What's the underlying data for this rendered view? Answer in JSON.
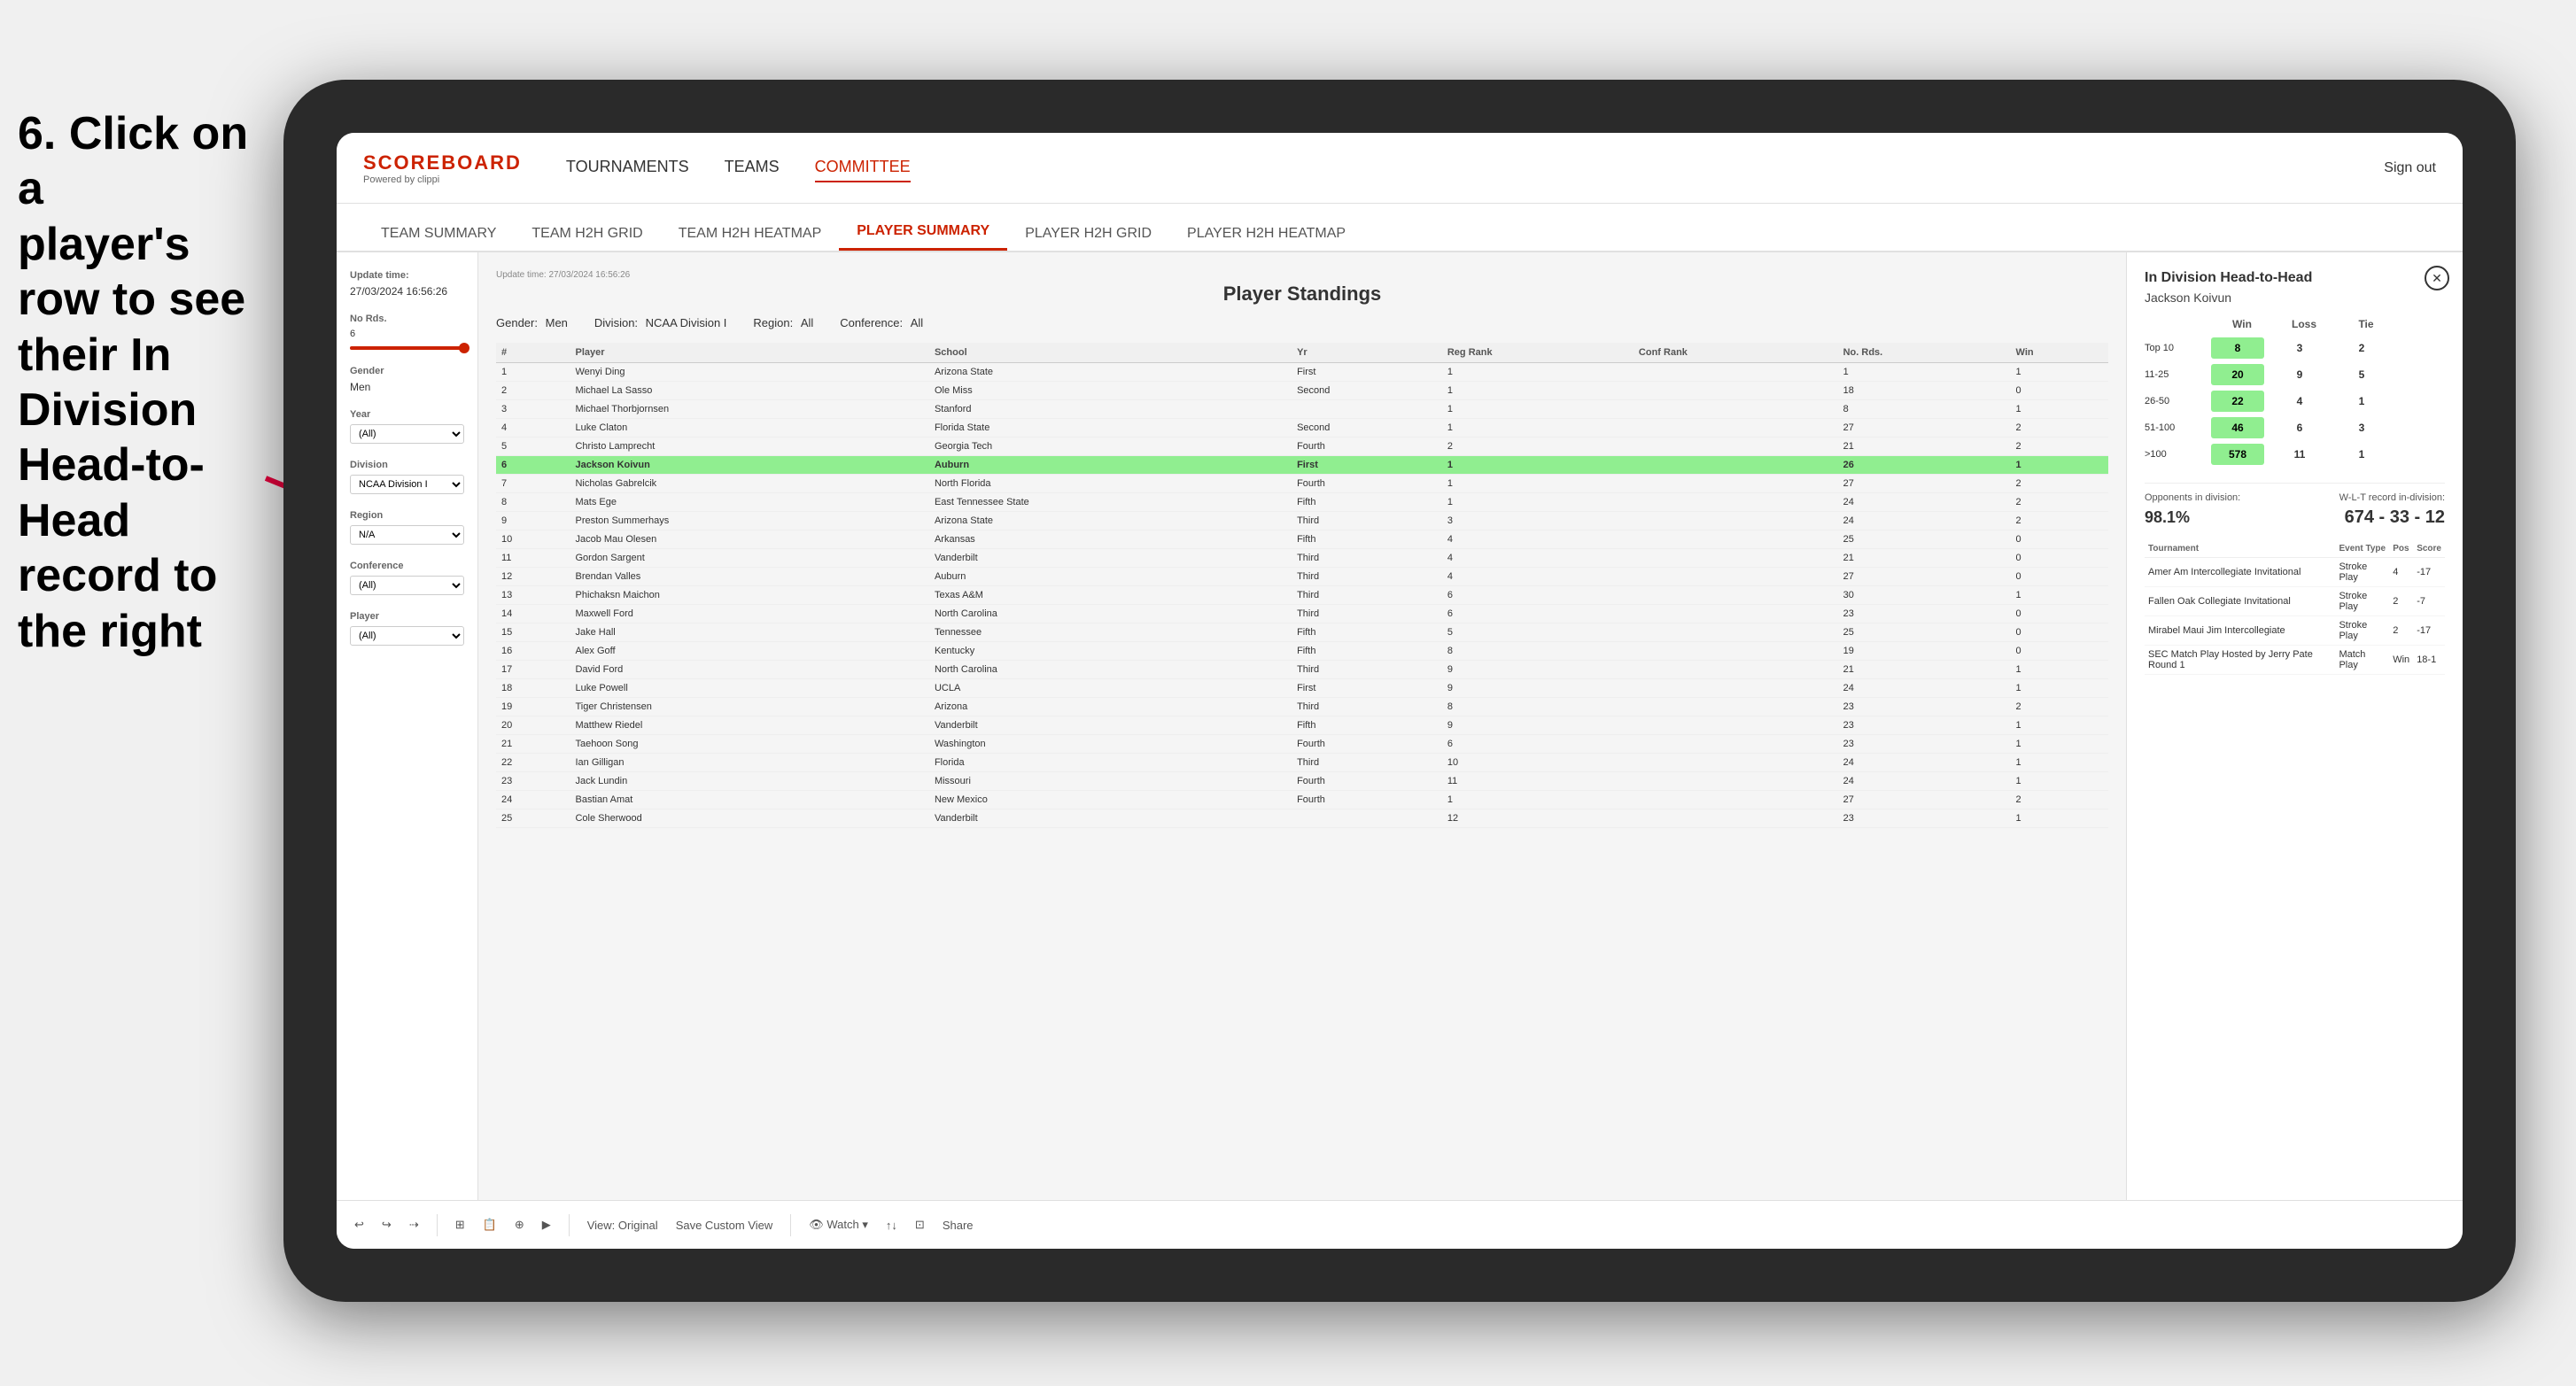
{
  "instruction": {
    "line1": "6. Click on a",
    "line2": "player's row to see",
    "line3": "their In Division",
    "line4": "Head-to-Head",
    "line5": "record to the right"
  },
  "nav": {
    "logo": "SCOREBOARD",
    "logo_sub": "Powered by clippi",
    "items": [
      "TOURNAMENTS",
      "TEAMS",
      "COMMITTEE"
    ],
    "sign_out": "Sign out"
  },
  "sub_nav": {
    "items": [
      "TEAM SUMMARY",
      "TEAM H2H GRID",
      "TEAM H2H HEATMAP",
      "PLAYER SUMMARY",
      "PLAYER H2H GRID",
      "PLAYER H2H HEATMAP"
    ],
    "active": "PLAYER SUMMARY"
  },
  "sidebar": {
    "update_time_label": "Update time:",
    "update_time": "27/03/2024 16:56:26",
    "no_rds_label": "No Rds.",
    "no_rds_value": "6",
    "no_rds_display": "6",
    "gender_label": "Gender",
    "gender_value": "Men",
    "year_label": "Year",
    "year_value": "(All)",
    "division_label": "Division",
    "division_value": "NCAA Division I",
    "region_label": "Region",
    "region_value": "N/A",
    "conference_label": "Conference",
    "conference_value": "(All)",
    "player_label": "Player",
    "player_value": "(All)"
  },
  "standings": {
    "title": "Player Standings",
    "gender_label": "Gender:",
    "gender_value": "Men",
    "division_label": "Division:",
    "division_value": "NCAA Division I",
    "region_label": "Region:",
    "region_value": "All",
    "conference_label": "Conference:",
    "conference_value": "All",
    "columns": [
      "#",
      "Player",
      "School",
      "Yr",
      "Reg Rank",
      "Conf Rank",
      "No. Rds.",
      "Win"
    ],
    "rows": [
      {
        "num": 1,
        "player": "Wenyi Ding",
        "school": "Arizona State",
        "yr": "First",
        "reg_rank": 1,
        "conf_rank": "",
        "no_rds": 1,
        "win": 1
      },
      {
        "num": 2,
        "player": "Michael La Sasso",
        "school": "Ole Miss",
        "yr": "Second",
        "reg_rank": 1,
        "conf_rank": "",
        "no_rds": 18,
        "win": 0
      },
      {
        "num": 3,
        "player": "Michael Thorbjornsen",
        "school": "Stanford",
        "yr": "",
        "reg_rank": 1,
        "conf_rank": "",
        "no_rds": 8,
        "win": 1
      },
      {
        "num": 4,
        "player": "Luke Claton",
        "school": "Florida State",
        "yr": "Second",
        "reg_rank": 1,
        "conf_rank": "",
        "no_rds": 27,
        "win": 2
      },
      {
        "num": 5,
        "player": "Christo Lamprecht",
        "school": "Georgia Tech",
        "yr": "Fourth",
        "reg_rank": 2,
        "conf_rank": "",
        "no_rds": 21,
        "win": 2
      },
      {
        "num": 6,
        "player": "Jackson Koivun",
        "school": "Auburn",
        "yr": "First",
        "reg_rank": 1,
        "conf_rank": "",
        "no_rds": 26,
        "win": 1,
        "highlighted": true
      },
      {
        "num": 7,
        "player": "Nicholas Gabrelcik",
        "school": "North Florida",
        "yr": "Fourth",
        "reg_rank": 1,
        "conf_rank": "",
        "no_rds": 27,
        "win": 2
      },
      {
        "num": 8,
        "player": "Mats Ege",
        "school": "East Tennessee State",
        "yr": "Fifth",
        "reg_rank": 1,
        "conf_rank": "",
        "no_rds": 24,
        "win": 2
      },
      {
        "num": 9,
        "player": "Preston Summerhays",
        "school": "Arizona State",
        "yr": "Third",
        "reg_rank": 3,
        "conf_rank": "",
        "no_rds": 24,
        "win": 2
      },
      {
        "num": 10,
        "player": "Jacob Mau Olesen",
        "school": "Arkansas",
        "yr": "Fifth",
        "reg_rank": 4,
        "conf_rank": "",
        "no_rds": 25,
        "win": 0
      },
      {
        "num": 11,
        "player": "Gordon Sargent",
        "school": "Vanderbilt",
        "yr": "Third",
        "reg_rank": 4,
        "conf_rank": "",
        "no_rds": 21,
        "win": 0
      },
      {
        "num": 12,
        "player": "Brendan Valles",
        "school": "Auburn",
        "yr": "Third",
        "reg_rank": 4,
        "conf_rank": "",
        "no_rds": 27,
        "win": 0
      },
      {
        "num": 13,
        "player": "Phichaksn Maichon",
        "school": "Texas A&M",
        "yr": "Third",
        "reg_rank": 6,
        "conf_rank": "",
        "no_rds": 30,
        "win": 1
      },
      {
        "num": 14,
        "player": "Maxwell Ford",
        "school": "North Carolina",
        "yr": "Third",
        "reg_rank": 6,
        "conf_rank": "",
        "no_rds": 23,
        "win": 0
      },
      {
        "num": 15,
        "player": "Jake Hall",
        "school": "Tennessee",
        "yr": "Fifth",
        "reg_rank": 5,
        "conf_rank": "",
        "no_rds": 25,
        "win": 0
      },
      {
        "num": 16,
        "player": "Alex Goff",
        "school": "Kentucky",
        "yr": "Fifth",
        "reg_rank": 8,
        "conf_rank": "",
        "no_rds": 19,
        "win": 0
      },
      {
        "num": 17,
        "player": "David Ford",
        "school": "North Carolina",
        "yr": "Third",
        "reg_rank": 9,
        "conf_rank": "",
        "no_rds": 21,
        "win": 1
      },
      {
        "num": 18,
        "player": "Luke Powell",
        "school": "UCLA",
        "yr": "First",
        "reg_rank": 9,
        "conf_rank": "",
        "no_rds": 24,
        "win": 1
      },
      {
        "num": 19,
        "player": "Tiger Christensen",
        "school": "Arizona",
        "yr": "Third",
        "reg_rank": 8,
        "conf_rank": "",
        "no_rds": 23,
        "win": 2
      },
      {
        "num": 20,
        "player": "Matthew Riedel",
        "school": "Vanderbilt",
        "yr": "Fifth",
        "reg_rank": 9,
        "conf_rank": "",
        "no_rds": 23,
        "win": 1
      },
      {
        "num": 21,
        "player": "Taehoon Song",
        "school": "Washington",
        "yr": "Fourth",
        "reg_rank": 6,
        "conf_rank": "",
        "no_rds": 23,
        "win": 1
      },
      {
        "num": 22,
        "player": "Ian Gilligan",
        "school": "Florida",
        "yr": "Third",
        "reg_rank": 10,
        "conf_rank": "",
        "no_rds": 24,
        "win": 1
      },
      {
        "num": 23,
        "player": "Jack Lundin",
        "school": "Missouri",
        "yr": "Fourth",
        "reg_rank": 11,
        "conf_rank": "",
        "no_rds": 24,
        "win": 1
      },
      {
        "num": 24,
        "player": "Bastian Amat",
        "school": "New Mexico",
        "yr": "Fourth",
        "reg_rank": 1,
        "conf_rank": "",
        "no_rds": 27,
        "win": 2
      },
      {
        "num": 25,
        "player": "Cole Sherwood",
        "school": "Vanderbilt",
        "yr": "",
        "reg_rank": 12,
        "conf_rank": "",
        "no_rds": 23,
        "win": 1
      }
    ]
  },
  "h2h": {
    "title": "In Division Head-to-Head",
    "player": "Jackson Koivun",
    "columns": [
      "Win",
      "Loss",
      "Tie"
    ],
    "rows": [
      {
        "range": "Top 10",
        "win": 8,
        "loss": 3,
        "tie": 2
      },
      {
        "range": "11-25",
        "win": 20,
        "loss": 9,
        "tie": 5
      },
      {
        "range": "26-50",
        "win": 22,
        "loss": 4,
        "tie": 1
      },
      {
        "range": "51-100",
        "win": 46,
        "loss": 6,
        "tie": 3
      },
      {
        "range": ">100",
        "win": 578,
        "loss": 11,
        "tie": 1
      }
    ],
    "opponents_label": "Opponents in division:",
    "wl_label": "W-L-T record in-division:",
    "pct": "98.1%",
    "wl_record": "674 - 33 - 12",
    "tournament_cols": [
      "Tournament",
      "Event Type",
      "Pos",
      "Score"
    ],
    "tournaments": [
      {
        "name": "Amer Am Intercollegiate Invitational",
        "type": "Stroke Play",
        "pos": 4,
        "score": "-17"
      },
      {
        "name": "Fallen Oak Collegiate Invitational",
        "type": "Stroke Play",
        "pos": 2,
        "score": "-7"
      },
      {
        "name": "Mirabel Maui Jim Intercollegiate",
        "type": "Stroke Play",
        "pos": 2,
        "score": "-17"
      },
      {
        "name": "SEC Match Play Hosted by Jerry Pate Round 1",
        "type": "Match Play",
        "pos": "Win",
        "score": "18-1"
      }
    ]
  },
  "toolbar": {
    "items": [
      "↩",
      "↪",
      "⇢",
      "⊞",
      "📋",
      "⊕",
      "▶",
      "View: Original",
      "Save Custom View",
      "👁 Watch ▾",
      "↑↓",
      "⊡",
      "Share"
    ]
  }
}
